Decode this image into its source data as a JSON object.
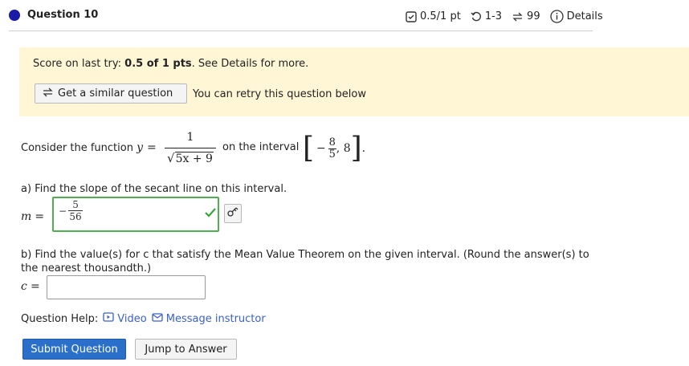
{
  "header": {
    "title": "Question 10",
    "points": "0.5/1 pt",
    "attempts": "1-3",
    "retries": "99",
    "details_label": "Details",
    "status_color": "#1a1aa8"
  },
  "banner": {
    "score_prefix": "Score on last try: ",
    "score_value": "0.5 of 1 pts",
    "score_suffix": ". See Details for more.",
    "similar_button": "Get a similar question",
    "retry_text": "You can retry this question below",
    "background": "#fff6d6"
  },
  "question": {
    "intro": "Consider the function ",
    "y_var": "y",
    "equals": "=",
    "numerator": "1",
    "denominator": "5x + 9",
    "on_interval": "on the interval",
    "interval_left_num": "8",
    "interval_left_den": "5",
    "interval_right": "8"
  },
  "part_a": {
    "prompt": "a) Find the slope of the secant line on this interval.",
    "var": "m",
    "answer_num": "5",
    "answer_den": "56",
    "answer_sign": "−",
    "status": "correct"
  },
  "part_b": {
    "prompt": "b) Find the value(s) for c that satisfy the Mean Value Theorem on the given interval. (Round the answer(s) to the nearest thousandth.)",
    "var": "c",
    "value": ""
  },
  "help": {
    "label": "Question Help:",
    "video": "Video",
    "message": "Message instructor"
  },
  "actions": {
    "submit": "Submit Question",
    "jump": "Jump to Answer"
  }
}
